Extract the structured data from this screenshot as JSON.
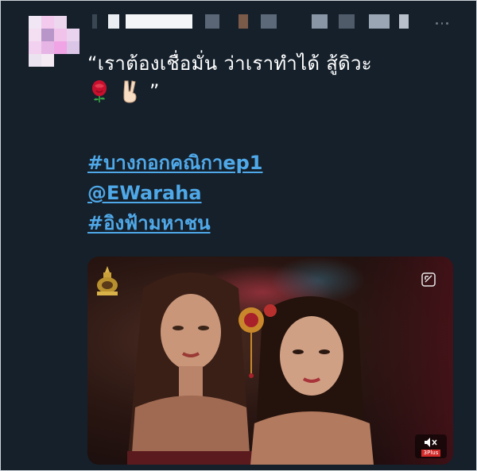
{
  "tweet": {
    "text": "“เราต้องเชื่อมั่น ว่าเราทำได้ สู้ดิวะ",
    "emoji_suffix": "”",
    "hashtags": [
      "#บางกอกคณิกาep1",
      "@EWaraha",
      "#อิงฟ้ามหาชน"
    ]
  },
  "video": {
    "channel_badge": "3Plus"
  },
  "colors": {
    "background": "#15202b",
    "link": "#4fa8e8",
    "text": "#ffffff"
  },
  "icons": [
    "avatar",
    "rose-icon",
    "victory-hand-icon",
    "seal-icon",
    "sensitive-media-icon",
    "mute-icon",
    "more-icon"
  ]
}
